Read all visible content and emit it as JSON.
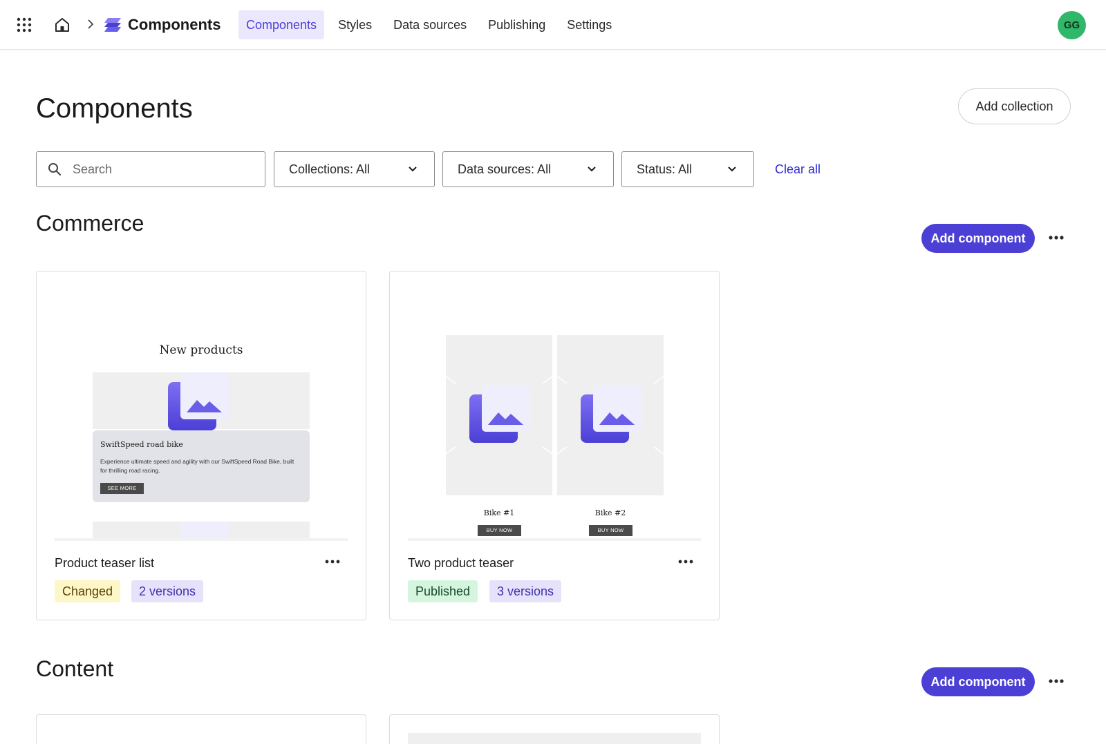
{
  "topbar": {
    "app_title": "Components",
    "tabs": [
      {
        "label": "Components",
        "active": true
      },
      {
        "label": "Styles",
        "active": false
      },
      {
        "label": "Data sources",
        "active": false
      },
      {
        "label": "Publishing",
        "active": false
      },
      {
        "label": "Settings",
        "active": false
      }
    ],
    "avatar_initials": "GG",
    "icons": [
      "apps-grid-icon",
      "home-icon",
      "chevron-right-icon",
      "app-logo-icon"
    ]
  },
  "page": {
    "title": "Components",
    "add_collection_label": "Add collection"
  },
  "filters": {
    "search_placeholder": "Search",
    "collections": "Collections: All",
    "data_sources": "Data sources: All",
    "status": "Status: All",
    "clear_all": "Clear all"
  },
  "sections": [
    {
      "title": "Commerce",
      "add_label": "Add component",
      "cards": [
        {
          "name": "Product teaser list",
          "status": "Changed",
          "versions": "2 versions",
          "preview": {
            "heading": "New products",
            "item_title": "SwiftSpeed road bike",
            "item_text": "Experience ultimate speed and agility with our SwiftSpeed Road Bike, built for thrilling road racing.",
            "button": "SEE MORE"
          }
        },
        {
          "name": "Two product teaser",
          "status": "Published",
          "versions": "3 versions",
          "preview": {
            "item1": "Bike #1",
            "item2": "Bike #2",
            "button": "BUY NOW"
          }
        }
      ]
    },
    {
      "title": "Content",
      "add_label": "Add component"
    }
  ],
  "colors": {
    "accent": "#4b3fd6",
    "accent_soft": "#ebe7fd",
    "avatar": "#2fb86a",
    "changed_bg": "#fdf7c8",
    "published_bg": "#d6f5df",
    "versions_bg": "#e6e2fb"
  }
}
